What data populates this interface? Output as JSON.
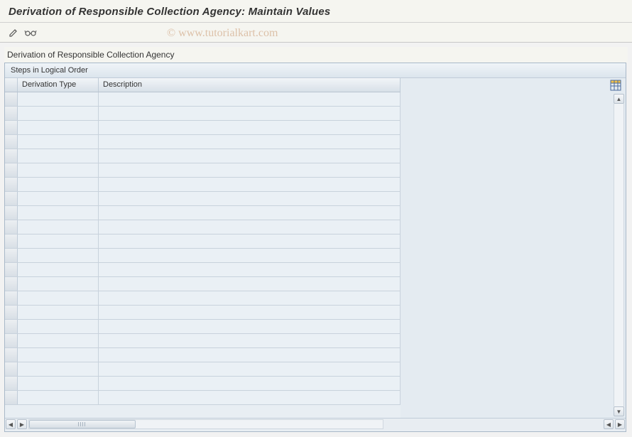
{
  "title": "Derivation of Responsible Collection Agency: Maintain Values",
  "watermark": "© www.tutorialkart.com",
  "section_label": "Derivation of Responsible Collection Agency",
  "panel": {
    "header": "Steps in Logical Order",
    "columns": {
      "derivation_type": "Derivation Type",
      "description": "Description"
    },
    "rows": [
      {
        "derivation_type": "",
        "description": ""
      },
      {
        "derivation_type": "",
        "description": ""
      },
      {
        "derivation_type": "",
        "description": ""
      },
      {
        "derivation_type": "",
        "description": ""
      },
      {
        "derivation_type": "",
        "description": ""
      },
      {
        "derivation_type": "",
        "description": ""
      },
      {
        "derivation_type": "",
        "description": ""
      },
      {
        "derivation_type": "",
        "description": ""
      },
      {
        "derivation_type": "",
        "description": ""
      },
      {
        "derivation_type": "",
        "description": ""
      },
      {
        "derivation_type": "",
        "description": ""
      },
      {
        "derivation_type": "",
        "description": ""
      },
      {
        "derivation_type": "",
        "description": ""
      },
      {
        "derivation_type": "",
        "description": ""
      },
      {
        "derivation_type": "",
        "description": ""
      },
      {
        "derivation_type": "",
        "description": ""
      },
      {
        "derivation_type": "",
        "description": ""
      },
      {
        "derivation_type": "",
        "description": ""
      },
      {
        "derivation_type": "",
        "description": ""
      },
      {
        "derivation_type": "",
        "description": ""
      },
      {
        "derivation_type": "",
        "description": ""
      },
      {
        "derivation_type": "",
        "description": ""
      }
    ]
  },
  "icons": {
    "pencil": "pencil-icon",
    "glasses": "glasses-icon",
    "config": "table-settings-icon"
  }
}
